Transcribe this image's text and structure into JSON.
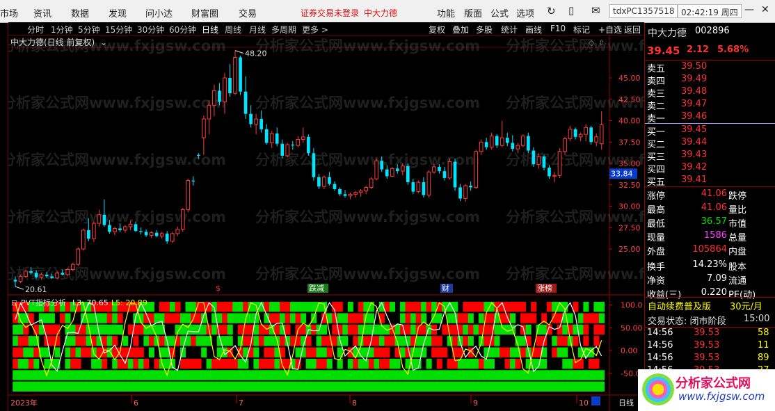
{
  "menubar": {
    "items": [
      "市场",
      "资讯",
      "数据",
      "发现",
      "问小达",
      "财富圈",
      "交易"
    ],
    "status_notice": "证券交易未登录",
    "active_stock": "中大力德",
    "right_items": [
      "功能",
      "版面",
      "公式",
      "选项"
    ],
    "account": "tdxPC1357518",
    "clock": "02:42:19 周四"
  },
  "periods": [
    "分时",
    "1分钟",
    "5分钟",
    "15分钟",
    "30分钟",
    "60分钟",
    "日线",
    "周线",
    "月线",
    "多周期",
    "更多 >"
  ],
  "active_period": "日线",
  "toolbar": [
    "复权",
    "叠加",
    "多股",
    "统计",
    "画线",
    "F10",
    "标记",
    "+自选",
    "返回"
  ],
  "main_chart": {
    "title": "中大力德(日线 前复权)",
    "high_label": "48.20",
    "low_label": "20.61",
    "current_price_tag": "33.84",
    "y_ticks": [
      "45.00",
      "42.50",
      "40.00",
      "37.50",
      "35.00",
      "32.50",
      "30.00",
      "27.50",
      "25.00"
    ],
    "event_tags": [
      "$",
      "跌减",
      "财",
      "涨榜"
    ]
  },
  "indicator": {
    "title": "PVT指标分析",
    "l3": "L3: 70.65",
    "l5": "L5: 20.89",
    "y_ticks": [
      "100.0",
      "50.00",
      "0.00",
      "-50.00"
    ]
  },
  "date_axis": {
    "year_label": "2023年",
    "months": [
      "6",
      "7",
      "8",
      "9",
      "10"
    ],
    "tail": "日线"
  },
  "quote": {
    "name": "中大力德",
    "code": "002896",
    "price": "39.45",
    "change": "2.12",
    "pct": "5.68%",
    "asks": [
      {
        "label": "卖五",
        "price": "39.50"
      },
      {
        "label": "卖四",
        "price": "39.49"
      },
      {
        "label": "卖三",
        "price": "39.48"
      },
      {
        "label": "卖二",
        "price": "39.47"
      },
      {
        "label": "卖一",
        "price": "39.46"
      }
    ],
    "bids": [
      {
        "label": "买一",
        "price": "39.45"
      },
      {
        "label": "买二",
        "price": "39.44"
      },
      {
        "label": "买三",
        "price": "39.43"
      },
      {
        "label": "买四",
        "price": "39.42"
      },
      {
        "label": "买五",
        "price": "39.41"
      }
    ],
    "stats": [
      {
        "label": "涨停",
        "value": "41.06",
        "right": "跌停",
        "color": "red"
      },
      {
        "label": "最高",
        "value": "41.06",
        "right": "量比",
        "color": "red"
      },
      {
        "label": "最低",
        "value": "36.57",
        "right": "市值",
        "color": "grn"
      },
      {
        "label": "现量",
        "value": "1586",
        "right": "总量",
        "color": "mag"
      },
      {
        "label": "外盘",
        "value": "105864",
        "right": "内盘",
        "color": "red"
      },
      {
        "label": "换手",
        "value": "14.23%",
        "right": "股本",
        "color": "wht"
      },
      {
        "label": "净资",
        "value": "7.09",
        "right": "流通",
        "color": "wht"
      },
      {
        "label": "收益(三)",
        "value": "0.220",
        "right": "PE(动)",
        "color": "wht"
      }
    ],
    "promo": "自动续费普及版",
    "promo_price": "30元/月",
    "trade_status": "交易状态: 闭市阶段",
    "trade_time": "15:00",
    "ticks": [
      {
        "time": "14:56",
        "price": "39.53",
        "vol": "58"
      },
      {
        "time": "14:56",
        "price": "39.53",
        "vol": "11"
      },
      {
        "time": "14:56",
        "price": "39.53",
        "vol": "89"
      },
      {
        "time": "14:56",
        "price": "39.53",
        "vol": "27"
      }
    ]
  },
  "watermark": {
    "text": "分析家公式网www.fxjgsw.com",
    "logo_cn": "分析家公式网",
    "logo_url": "www.fxjgsw.com"
  },
  "colors": {
    "up": "#ff3b3b",
    "down": "#00e5ff",
    "grid": "#7a0000",
    "green": "#00e000",
    "red": "#ff0000"
  },
  "chart_data": {
    "type": "candlestick",
    "price_range": [
      20,
      50
    ],
    "candles": [
      [
        21.4,
        21.8,
        20.6,
        21.2
      ],
      [
        21.2,
        22.0,
        21.0,
        21.8
      ],
      [
        21.8,
        22.6,
        21.6,
        22.4
      ],
      [
        22.4,
        22.9,
        22.0,
        22.2
      ],
      [
        22.2,
        22.5,
        21.5,
        21.7
      ],
      [
        21.7,
        22.2,
        21.4,
        22.0
      ],
      [
        22.0,
        22.3,
        21.6,
        21.8
      ],
      [
        21.8,
        22.1,
        21.5,
        21.6
      ],
      [
        21.6,
        22.4,
        21.5,
        22.2
      ],
      [
        22.2,
        22.6,
        21.9,
        22.0
      ],
      [
        22.0,
        22.8,
        21.8,
        22.6
      ],
      [
        22.6,
        23.4,
        22.4,
        23.2
      ],
      [
        23.2,
        25.2,
        23.0,
        25.0
      ],
      [
        25.0,
        27.4,
        24.8,
        27.2
      ],
      [
        27.2,
        28.6,
        25.9,
        26.2
      ],
      [
        26.2,
        28.2,
        25.8,
        28.0
      ],
      [
        28.0,
        29.6,
        27.6,
        29.0
      ],
      [
        29.0,
        30.8,
        27.6,
        27.8
      ],
      [
        27.8,
        28.4,
        26.8,
        27.0
      ],
      [
        27.0,
        27.6,
        26.6,
        27.4
      ],
      [
        27.4,
        28.0,
        27.0,
        27.2
      ],
      [
        27.2,
        27.8,
        26.9,
        27.6
      ],
      [
        27.6,
        28.3,
        27.2,
        27.9
      ],
      [
        27.9,
        28.2,
        27.0,
        27.1
      ],
      [
        27.1,
        27.5,
        26.7,
        27.0
      ],
      [
        27.0,
        27.3,
        26.4,
        26.6
      ],
      [
        26.6,
        27.1,
        26.3,
        26.9
      ],
      [
        26.9,
        27.2,
        26.4,
        26.5
      ],
      [
        26.5,
        27.0,
        26.2,
        26.8
      ],
      [
        26.8,
        27.1,
        25.6,
        25.9
      ],
      [
        25.9,
        27.0,
        25.7,
        26.8
      ],
      [
        26.8,
        27.6,
        26.5,
        27.3
      ],
      [
        27.3,
        29.8,
        27.0,
        29.6
      ],
      [
        29.6,
        33.2,
        29.3,
        33.0
      ],
      [
        33.0,
        33.5,
        32.4,
        32.9
      ],
      [
        36.0,
        36.2,
        35.5,
        35.9
      ],
      [
        38.0,
        40.6,
        36.0,
        40.2
      ],
      [
        40.2,
        42.4,
        38.4,
        41.8
      ],
      [
        41.8,
        44.2,
        40.5,
        43.5
      ],
      [
        43.5,
        44.4,
        41.8,
        42.2
      ],
      [
        42.2,
        45.6,
        40.8,
        45.0
      ],
      [
        45.0,
        46.6,
        42.8,
        43.2
      ],
      [
        43.2,
        48.2,
        43.0,
        47.4
      ],
      [
        47.4,
        47.6,
        43.0,
        43.4
      ],
      [
        43.4,
        45.2,
        40.2,
        40.8
      ],
      [
        40.8,
        41.8,
        39.2,
        39.6
      ],
      [
        39.6,
        40.8,
        38.4,
        40.2
      ],
      [
        40.2,
        41.2,
        38.6,
        39.0
      ],
      [
        39.0,
        39.6,
        37.2,
        37.4
      ],
      [
        37.4,
        38.8,
        36.8,
        38.5
      ],
      [
        38.5,
        39.2,
        37.0,
        37.3
      ],
      [
        37.3,
        37.8,
        35.6,
        35.9
      ],
      [
        35.9,
        37.4,
        35.7,
        37.2
      ],
      [
        37.2,
        37.6,
        36.6,
        37.1
      ],
      [
        37.1,
        38.2,
        36.9,
        37.8
      ],
      [
        37.8,
        39.2,
        37.4,
        38.1
      ],
      [
        38.1,
        38.4,
        35.9,
        36.2
      ],
      [
        36.2,
        36.8,
        33.0,
        33.4
      ],
      [
        33.4,
        33.8,
        32.0,
        32.3
      ],
      [
        32.3,
        33.6,
        32.0,
        33.4
      ],
      [
        33.4,
        34.0,
        32.4,
        32.6
      ],
      [
        32.6,
        32.9,
        31.8,
        32.0
      ],
      [
        32.0,
        32.2,
        31.2,
        31.4
      ],
      [
        31.4,
        31.9,
        31.0,
        31.2
      ],
      [
        31.2,
        31.6,
        30.8,
        31.4
      ],
      [
        31.4,
        31.8,
        31.0,
        31.6
      ],
      [
        31.6,
        32.0,
        31.1,
        31.8
      ],
      [
        31.8,
        32.4,
        31.4,
        32.2
      ],
      [
        32.2,
        33.4,
        32.0,
        33.2
      ],
      [
        33.2,
        35.6,
        33.0,
        35.3
      ],
      [
        35.3,
        35.8,
        34.0,
        34.3
      ],
      [
        34.3,
        34.8,
        33.2,
        33.5
      ],
      [
        33.5,
        34.6,
        33.4,
        34.4
      ],
      [
        34.4,
        34.9,
        33.8,
        34.1
      ],
      [
        34.1,
        35.0,
        33.6,
        34.7
      ],
      [
        34.7,
        35.0,
        32.5,
        32.8
      ],
      [
        32.8,
        33.2,
        31.4,
        31.7
      ],
      [
        31.7,
        33.0,
        31.5,
        32.8
      ],
      [
        32.8,
        33.4,
        31.0,
        31.3
      ],
      [
        31.3,
        34.2,
        31.0,
        34.0
      ],
      [
        34.0,
        35.0,
        33.8,
        34.6
      ],
      [
        34.6,
        34.9,
        33.8,
        34.1
      ],
      [
        34.1,
        34.6,
        33.0,
        33.3
      ],
      [
        33.3,
        35.6,
        33.1,
        35.2
      ],
      [
        35.2,
        35.6,
        31.8,
        32.2
      ],
      [
        32.2,
        32.6,
        30.6,
        30.9
      ],
      [
        30.9,
        32.6,
        30.5,
        32.4
      ],
      [
        32.4,
        32.9,
        31.8,
        32.2
      ],
      [
        32.2,
        36.6,
        32.0,
        36.4
      ],
      [
        36.4,
        37.8,
        36.0,
        37.5
      ],
      [
        37.5,
        38.0,
        36.6,
        36.9
      ],
      [
        36.9,
        38.6,
        36.6,
        38.2
      ],
      [
        38.2,
        38.4,
        36.8,
        37.1
      ],
      [
        37.1,
        40.0,
        36.9,
        38.0
      ],
      [
        38.0,
        38.6,
        37.0,
        37.4
      ],
      [
        37.4,
        38.3,
        36.4,
        36.7
      ],
      [
        36.7,
        37.4,
        36.2,
        37.1
      ],
      [
        37.1,
        38.4,
        36.9,
        38.2
      ],
      [
        38.2,
        38.6,
        36.2,
        36.5
      ],
      [
        36.5,
        36.9,
        34.6,
        34.9
      ],
      [
        34.9,
        36.2,
        34.4,
        35.8
      ],
      [
        35.8,
        36.0,
        34.2,
        34.5
      ],
      [
        34.5,
        34.8,
        33.2,
        33.5
      ],
      [
        33.5,
        34.0,
        32.8,
        33.6
      ],
      [
        33.6,
        36.8,
        33.3,
        36.4
      ],
      [
        36.4,
        38.1,
        36.0,
        37.9
      ],
      [
        37.9,
        39.4,
        37.6,
        39.0
      ],
      [
        39.0,
        39.2,
        37.8,
        38.1
      ],
      [
        38.1,
        38.6,
        37.6,
        38.4
      ],
      [
        38.4,
        39.6,
        37.6,
        39.2
      ],
      [
        39.2,
        39.4,
        37.2,
        37.5
      ],
      [
        37.5,
        38.5,
        37.0,
        38.1
      ],
      [
        37.3,
        41.1,
        36.6,
        39.5
      ]
    ],
    "indicator_series": {
      "L3": "white line, 0-100 oscillator",
      "L5": "yellow line, 0-100 oscillator",
      "last_L3": 70.65,
      "last_L5": 20.89,
      "y_range": [
        -90,
        110
      ]
    }
  }
}
